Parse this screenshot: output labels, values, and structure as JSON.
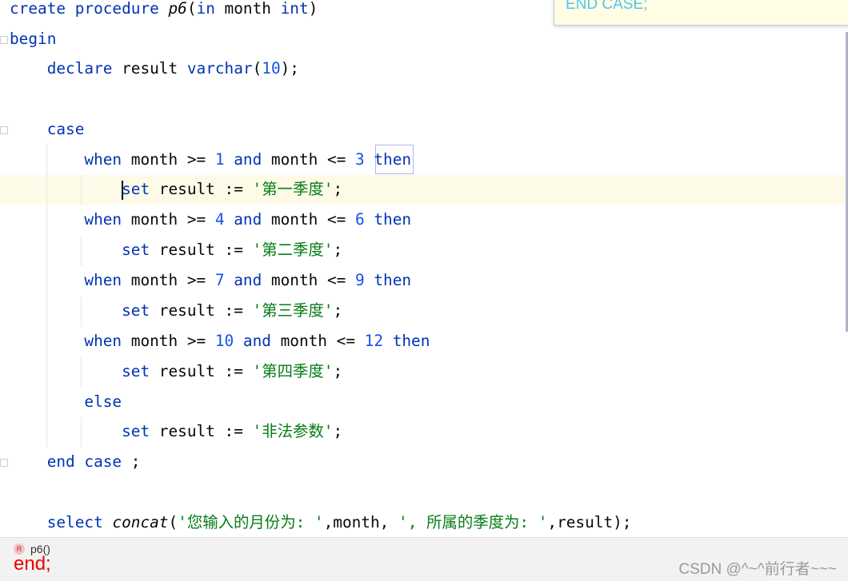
{
  "editor": {
    "lines": [
      [
        [
          "kw",
          "create procedure "
        ],
        [
          "it",
          "p6"
        ],
        [
          "",
          "("
        ],
        [
          "kw",
          "in "
        ],
        [
          "",
          "month "
        ],
        [
          "kw",
          "int"
        ],
        [
          "",
          ")"
        ]
      ],
      [
        [
          "kw",
          "begin"
        ]
      ],
      [
        [
          "",
          "    "
        ],
        [
          "kw",
          "declare "
        ],
        [
          "",
          "result "
        ],
        [
          "kw",
          "varchar"
        ],
        [
          "",
          "("
        ],
        [
          "num",
          "10"
        ],
        [
          "",
          ");"
        ]
      ],
      [],
      [
        [
          "",
          "    "
        ],
        [
          "kw",
          "case"
        ]
      ],
      [
        [
          "",
          "        "
        ],
        [
          "kw",
          "when "
        ],
        [
          "",
          "month >= "
        ],
        [
          "num",
          "1"
        ],
        [
          "kw",
          " and "
        ],
        [
          "",
          "month <= "
        ],
        [
          "num",
          "3"
        ],
        [
          "kw",
          " then"
        ]
      ],
      [
        [
          "",
          "            "
        ],
        [
          "kw",
          "set "
        ],
        [
          "",
          "result := "
        ],
        [
          "str",
          "'第一季度'"
        ],
        [
          "",
          ";"
        ]
      ],
      [
        [
          "",
          "        "
        ],
        [
          "kw",
          "when "
        ],
        [
          "",
          "month >= "
        ],
        [
          "num",
          "4"
        ],
        [
          "kw",
          " and "
        ],
        [
          "",
          "month <= "
        ],
        [
          "num",
          "6"
        ],
        [
          "kw",
          " then"
        ]
      ],
      [
        [
          "",
          "            "
        ],
        [
          "kw",
          "set "
        ],
        [
          "",
          "result := "
        ],
        [
          "str",
          "'第二季度'"
        ],
        [
          "",
          ";"
        ]
      ],
      [
        [
          "",
          "        "
        ],
        [
          "kw",
          "when "
        ],
        [
          "",
          "month >= "
        ],
        [
          "num",
          "7"
        ],
        [
          "kw",
          " and "
        ],
        [
          "",
          "month <= "
        ],
        [
          "num",
          "9"
        ],
        [
          "kw",
          " then"
        ]
      ],
      [
        [
          "",
          "            "
        ],
        [
          "kw",
          "set "
        ],
        [
          "",
          "result := "
        ],
        [
          "str",
          "'第三季度'"
        ],
        [
          "",
          ";"
        ]
      ],
      [
        [
          "",
          "        "
        ],
        [
          "kw",
          "when "
        ],
        [
          "",
          "month >= "
        ],
        [
          "num",
          "10"
        ],
        [
          "kw",
          " and "
        ],
        [
          "",
          "month <= "
        ],
        [
          "num",
          "12"
        ],
        [
          "kw",
          " then"
        ]
      ],
      [
        [
          "",
          "            "
        ],
        [
          "kw",
          "set "
        ],
        [
          "",
          "result := "
        ],
        [
          "str",
          "'第四季度'"
        ],
        [
          "",
          ";"
        ]
      ],
      [
        [
          "",
          "        "
        ],
        [
          "kw",
          "else"
        ]
      ],
      [
        [
          "",
          "            "
        ],
        [
          "kw",
          "set "
        ],
        [
          "",
          "result := "
        ],
        [
          "str",
          "'非法参数'"
        ],
        [
          "",
          ";"
        ]
      ],
      [
        [
          "",
          "    "
        ],
        [
          "kw",
          "end case "
        ],
        [
          "",
          ";"
        ]
      ],
      [],
      [
        [
          "",
          "    "
        ],
        [
          "kw",
          "select "
        ],
        [
          "it",
          "concat"
        ],
        [
          "",
          "("
        ],
        [
          "str",
          "'您输入的月份为: '"
        ],
        [
          "",
          ",month, "
        ],
        [
          "str",
          "', 所属的季度为: '"
        ],
        [
          "",
          ",result);"
        ]
      ]
    ]
  },
  "popup": {
    "text": "END CASE;"
  },
  "breadcrumb": {
    "badge": "R",
    "label": "p6()"
  },
  "overlay_text": "end;",
  "watermark": "CSDN @^~^前行者~~~",
  "colors": {
    "keyword": "#0033b3",
    "number": "#1750eb",
    "string": "#067d17",
    "popup_text": "#4fc3f7",
    "end_text": "#ee0000"
  }
}
